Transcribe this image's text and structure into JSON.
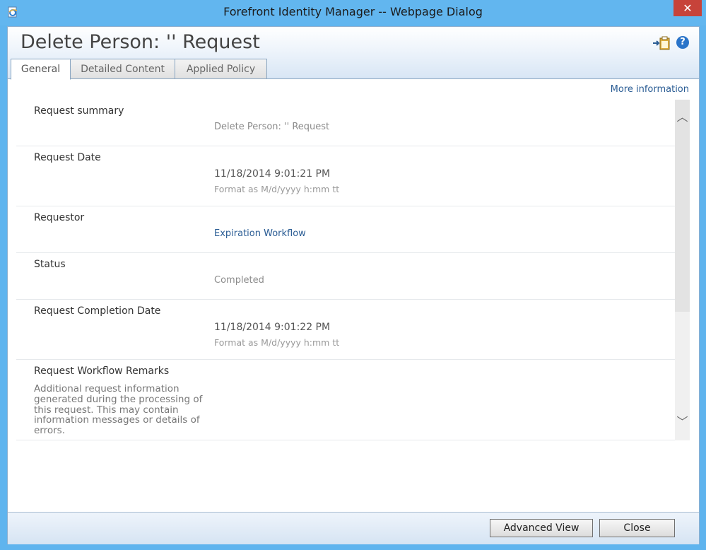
{
  "window": {
    "title": "Forefront Identity Manager -- Webpage Dialog",
    "close_glyph": "✕"
  },
  "header": {
    "page_title": "Delete Person: '' Request",
    "help_glyph": "?"
  },
  "tabs": [
    {
      "label": "General",
      "active": true
    },
    {
      "label": "Detailed Content",
      "active": false
    },
    {
      "label": "Applied Policy",
      "active": false
    }
  ],
  "more_information": "More information",
  "rows": {
    "summary": {
      "label": "Request summary",
      "value": "Delete Person: '' Request"
    },
    "request_date": {
      "label": "Request Date",
      "value": "11/18/2014 9:01:21 PM",
      "hint": "Format as M/d/yyyy h:mm tt"
    },
    "requestor": {
      "label": "Requestor",
      "value": "Expiration Workflow"
    },
    "status": {
      "label": "Status",
      "value": "Completed"
    },
    "completion_date": {
      "label": "Request Completion Date",
      "value": "11/18/2014 9:01:22 PM",
      "hint": "Format as M/d/yyyy h:mm tt"
    },
    "remarks": {
      "label": "Request Workflow Remarks",
      "description": "Additional request information generated during the processing of this request. This may contain information messages or details of errors."
    }
  },
  "scrollbar": {
    "up_glyph": "︿",
    "down_glyph": "﹀"
  },
  "footer": {
    "advanced_view": "Advanced View",
    "close": "Close"
  }
}
